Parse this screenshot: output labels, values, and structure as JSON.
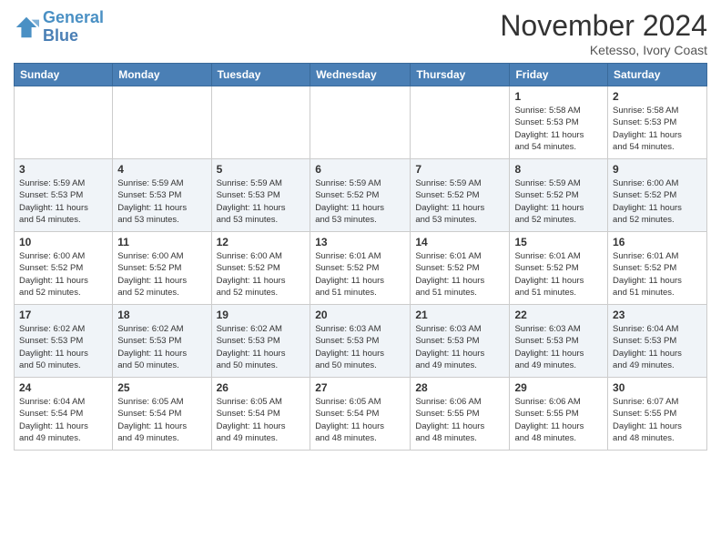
{
  "header": {
    "logo_line1": "General",
    "logo_line2": "Blue",
    "month_title": "November 2024",
    "location": "Ketesso, Ivory Coast"
  },
  "weekdays": [
    "Sunday",
    "Monday",
    "Tuesday",
    "Wednesday",
    "Thursday",
    "Friday",
    "Saturday"
  ],
  "weeks": [
    [
      {
        "day": "",
        "info": ""
      },
      {
        "day": "",
        "info": ""
      },
      {
        "day": "",
        "info": ""
      },
      {
        "day": "",
        "info": ""
      },
      {
        "day": "",
        "info": ""
      },
      {
        "day": "1",
        "info": "Sunrise: 5:58 AM\nSunset: 5:53 PM\nDaylight: 11 hours\nand 54 minutes."
      },
      {
        "day": "2",
        "info": "Sunrise: 5:58 AM\nSunset: 5:53 PM\nDaylight: 11 hours\nand 54 minutes."
      }
    ],
    [
      {
        "day": "3",
        "info": "Sunrise: 5:59 AM\nSunset: 5:53 PM\nDaylight: 11 hours\nand 54 minutes."
      },
      {
        "day": "4",
        "info": "Sunrise: 5:59 AM\nSunset: 5:53 PM\nDaylight: 11 hours\nand 53 minutes."
      },
      {
        "day": "5",
        "info": "Sunrise: 5:59 AM\nSunset: 5:53 PM\nDaylight: 11 hours\nand 53 minutes."
      },
      {
        "day": "6",
        "info": "Sunrise: 5:59 AM\nSunset: 5:52 PM\nDaylight: 11 hours\nand 53 minutes."
      },
      {
        "day": "7",
        "info": "Sunrise: 5:59 AM\nSunset: 5:52 PM\nDaylight: 11 hours\nand 53 minutes."
      },
      {
        "day": "8",
        "info": "Sunrise: 5:59 AM\nSunset: 5:52 PM\nDaylight: 11 hours\nand 52 minutes."
      },
      {
        "day": "9",
        "info": "Sunrise: 6:00 AM\nSunset: 5:52 PM\nDaylight: 11 hours\nand 52 minutes."
      }
    ],
    [
      {
        "day": "10",
        "info": "Sunrise: 6:00 AM\nSunset: 5:52 PM\nDaylight: 11 hours\nand 52 minutes."
      },
      {
        "day": "11",
        "info": "Sunrise: 6:00 AM\nSunset: 5:52 PM\nDaylight: 11 hours\nand 52 minutes."
      },
      {
        "day": "12",
        "info": "Sunrise: 6:00 AM\nSunset: 5:52 PM\nDaylight: 11 hours\nand 52 minutes."
      },
      {
        "day": "13",
        "info": "Sunrise: 6:01 AM\nSunset: 5:52 PM\nDaylight: 11 hours\nand 51 minutes."
      },
      {
        "day": "14",
        "info": "Sunrise: 6:01 AM\nSunset: 5:52 PM\nDaylight: 11 hours\nand 51 minutes."
      },
      {
        "day": "15",
        "info": "Sunrise: 6:01 AM\nSunset: 5:52 PM\nDaylight: 11 hours\nand 51 minutes."
      },
      {
        "day": "16",
        "info": "Sunrise: 6:01 AM\nSunset: 5:52 PM\nDaylight: 11 hours\nand 51 minutes."
      }
    ],
    [
      {
        "day": "17",
        "info": "Sunrise: 6:02 AM\nSunset: 5:53 PM\nDaylight: 11 hours\nand 50 minutes."
      },
      {
        "day": "18",
        "info": "Sunrise: 6:02 AM\nSunset: 5:53 PM\nDaylight: 11 hours\nand 50 minutes."
      },
      {
        "day": "19",
        "info": "Sunrise: 6:02 AM\nSunset: 5:53 PM\nDaylight: 11 hours\nand 50 minutes."
      },
      {
        "day": "20",
        "info": "Sunrise: 6:03 AM\nSunset: 5:53 PM\nDaylight: 11 hours\nand 50 minutes."
      },
      {
        "day": "21",
        "info": "Sunrise: 6:03 AM\nSunset: 5:53 PM\nDaylight: 11 hours\nand 49 minutes."
      },
      {
        "day": "22",
        "info": "Sunrise: 6:03 AM\nSunset: 5:53 PM\nDaylight: 11 hours\nand 49 minutes."
      },
      {
        "day": "23",
        "info": "Sunrise: 6:04 AM\nSunset: 5:53 PM\nDaylight: 11 hours\nand 49 minutes."
      }
    ],
    [
      {
        "day": "24",
        "info": "Sunrise: 6:04 AM\nSunset: 5:54 PM\nDaylight: 11 hours\nand 49 minutes."
      },
      {
        "day": "25",
        "info": "Sunrise: 6:05 AM\nSunset: 5:54 PM\nDaylight: 11 hours\nand 49 minutes."
      },
      {
        "day": "26",
        "info": "Sunrise: 6:05 AM\nSunset: 5:54 PM\nDaylight: 11 hours\nand 49 minutes."
      },
      {
        "day": "27",
        "info": "Sunrise: 6:05 AM\nSunset: 5:54 PM\nDaylight: 11 hours\nand 48 minutes."
      },
      {
        "day": "28",
        "info": "Sunrise: 6:06 AM\nSunset: 5:55 PM\nDaylight: 11 hours\nand 48 minutes."
      },
      {
        "day": "29",
        "info": "Sunrise: 6:06 AM\nSunset: 5:55 PM\nDaylight: 11 hours\nand 48 minutes."
      },
      {
        "day": "30",
        "info": "Sunrise: 6:07 AM\nSunset: 5:55 PM\nDaylight: 11 hours\nand 48 minutes."
      }
    ]
  ]
}
